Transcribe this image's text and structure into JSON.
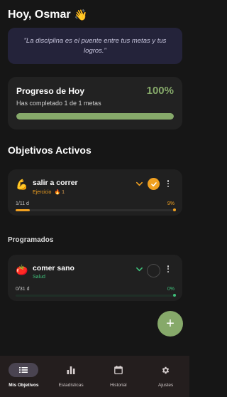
{
  "header": {
    "greeting": "Hoy, Osmar",
    "wave_icon": "waving-hand-icon"
  },
  "quote": {
    "text": "\"La disciplina es el puente entre tus metas y tus logros.\""
  },
  "today_progress": {
    "title": "Progreso de Hoy",
    "percent_label": "100%",
    "subtitle": "Has completado 1 de 1 metas",
    "percent": 100,
    "accent_color": "#86a96a"
  },
  "active_section": {
    "title": "Objetivos Activos"
  },
  "active_goals": [
    {
      "icon": "flexed-biceps-icon",
      "name": "salir a correr",
      "category": "Ejercicio",
      "streak": "🔥 1",
      "count": "1/11 d",
      "percent_label": "9%",
      "percent": 9,
      "color": "#f0a020",
      "completed": true
    }
  ],
  "scheduled_section": {
    "title": "Programados"
  },
  "scheduled_goals": [
    {
      "icon": "tomato-icon",
      "name": "comer sano",
      "category": "Salud",
      "count": "0/31 d",
      "percent_label": "0%",
      "percent": 0,
      "color": "#3fbf7a",
      "completed": false
    }
  ],
  "fab": {
    "icon": "plus-icon",
    "label": "+"
  },
  "nav": {
    "items": [
      {
        "label": "Mis Objetivos",
        "icon": "list-icon",
        "active": true
      },
      {
        "label": "Estadísticas",
        "icon": "bar-chart-icon",
        "active": false
      },
      {
        "label": "Historial",
        "icon": "calendar-icon",
        "active": false
      },
      {
        "label": "Ajustes",
        "icon": "gear-icon",
        "active": false
      }
    ]
  }
}
